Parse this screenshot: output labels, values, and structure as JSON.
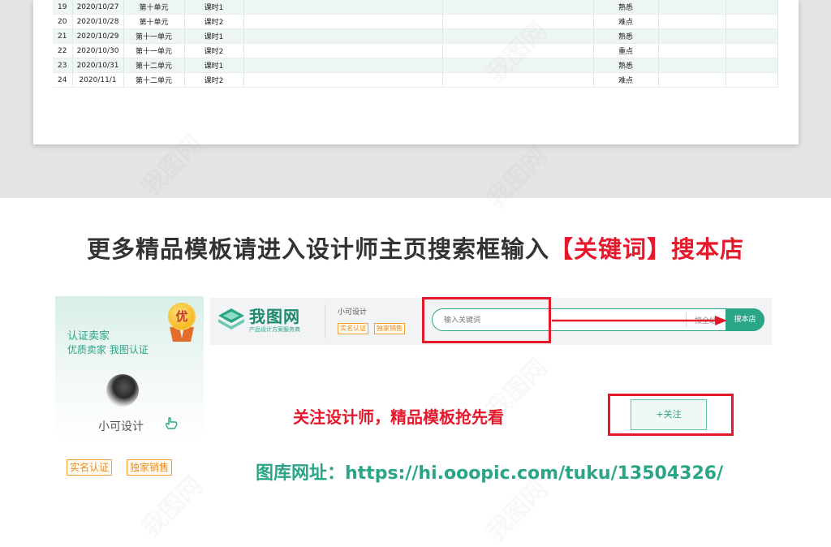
{
  "schedule": {
    "rows": [
      {
        "no": "19",
        "date": "2020/10/27",
        "unit": "第十单元",
        "lesson": "课时1",
        "note": "熟悉"
      },
      {
        "no": "20",
        "date": "2020/10/28",
        "unit": "第十单元",
        "lesson": "课时2",
        "note": "难点"
      },
      {
        "no": "21",
        "date": "2020/10/29",
        "unit": "第十一单元",
        "lesson": "课时1",
        "note": "熟悉"
      },
      {
        "no": "22",
        "date": "2020/10/30",
        "unit": "第十一单元",
        "lesson": "课时2",
        "note": "重点"
      },
      {
        "no": "23",
        "date": "2020/10/31",
        "unit": "第十二单元",
        "lesson": "课时1",
        "note": "熟悉"
      },
      {
        "no": "24",
        "date": "2020/11/1",
        "unit": "第十二单元",
        "lesson": "课时2",
        "note": "难点"
      }
    ]
  },
  "headline": {
    "main": "更多精品模板请进入设计师主页搜索框输入",
    "highlight": "【关键词】搜本店"
  },
  "seller": {
    "title": "认证卖家",
    "subtitle": "优质卖家 我图认证",
    "medal": "优",
    "name": "小可设计",
    "badge_verified": "实名认证",
    "badge_exclusive": "独家销售"
  },
  "store_bar": {
    "logo_text": "我图网",
    "logo_tagline": "产品设计方案服务商",
    "shop_name": "小可设计",
    "badge_verified": "实名认证",
    "badge_exclusive": "独家销售",
    "search_placeholder": "输入关键词",
    "search_site_label": "搜全站",
    "search_store_label": "搜本店"
  },
  "follow": {
    "tip": "关注设计师，精品模板抢先看",
    "button": "+关注"
  },
  "url_line": "图库网址：https://hi.ooopic.com/tuku/13504326/",
  "colors": {
    "brand_green": "#2aa586",
    "accent_red": "#e5192b",
    "badge_orange": "#e98b1e"
  }
}
